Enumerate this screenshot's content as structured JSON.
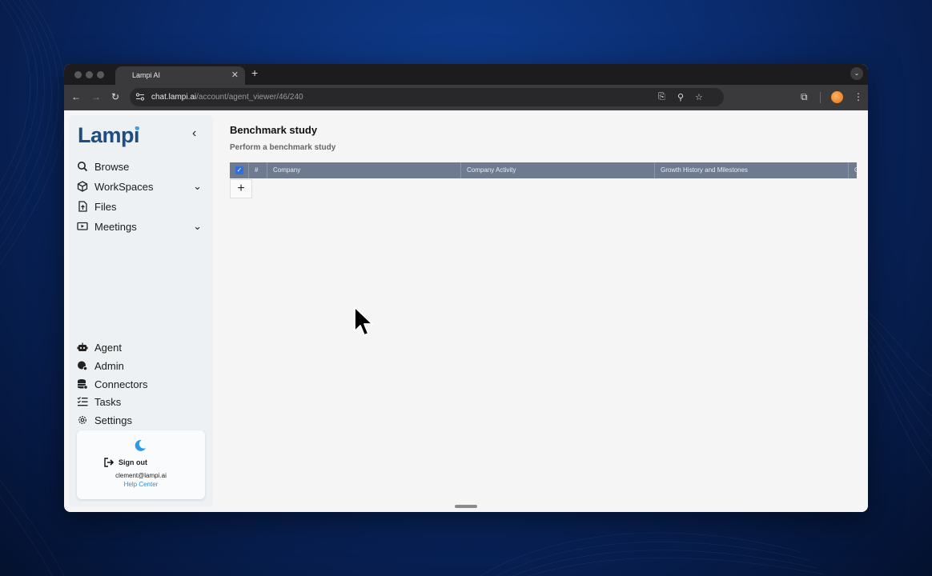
{
  "browser": {
    "tab_title": "Lampi AI",
    "tab_close": "✕",
    "new_tab": "+",
    "url_host": "chat.lampi.ai",
    "url_path": "/account/agent_viewer/46/240"
  },
  "sidebar": {
    "logo": "Lampi",
    "nav_top": [
      {
        "label": "Browse",
        "icon": "search-icon"
      },
      {
        "label": "WorkSpaces",
        "icon": "cube-icon"
      },
      {
        "label": "Files",
        "icon": "file-icon"
      },
      {
        "label": "Meetings",
        "icon": "video-icon"
      }
    ],
    "nav_bottom": [
      {
        "label": "Agent",
        "icon": "robot-icon"
      },
      {
        "label": "Admin",
        "icon": "admin-icon"
      },
      {
        "label": "Connectors",
        "icon": "database-icon"
      },
      {
        "label": "Tasks",
        "icon": "tasks-icon"
      },
      {
        "label": "Settings",
        "icon": "gear-icon"
      }
    ],
    "card": {
      "signout": "Sign out",
      "email": "clement@lampi.ai",
      "help": "Help Center"
    }
  },
  "main": {
    "title": "Benchmark study",
    "subtitle": "Perform a benchmark study",
    "table": {
      "columns": [
        "#",
        "Company",
        "Company Activity",
        "Growth History and Milestones",
        "C"
      ],
      "add_row": "+"
    }
  },
  "colors": {
    "accent": "#2f6fe0",
    "logo": "#1e4d82",
    "table_header": "#6d7a90",
    "link": "#2f8fd8"
  }
}
